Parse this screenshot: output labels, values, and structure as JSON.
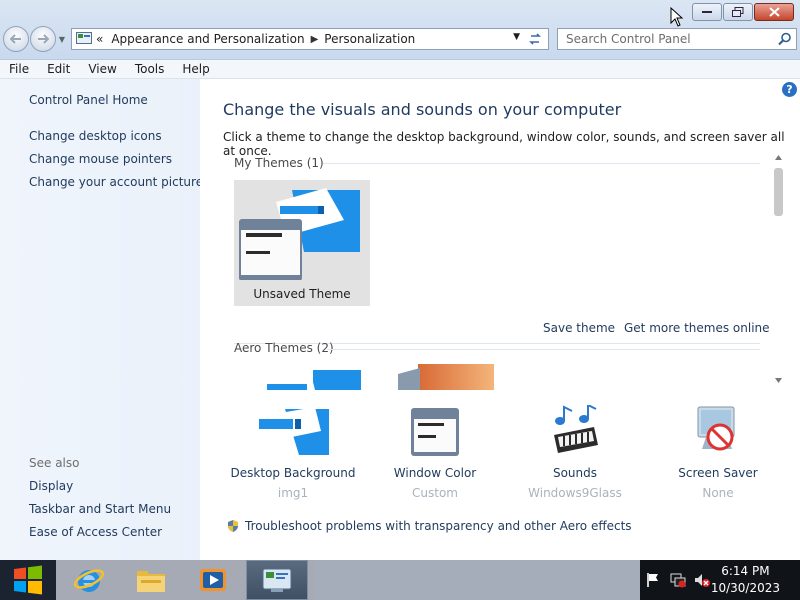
{
  "window": {
    "breadcrumb": [
      "Appearance and Personalization",
      "Personalization"
    ],
    "breadcrumb_overflow": "«",
    "search_placeholder": "Search Control Panel"
  },
  "menu": [
    "File",
    "Edit",
    "View",
    "Tools",
    "Help"
  ],
  "sidebar": {
    "home": "Control Panel Home",
    "links": [
      "Change desktop icons",
      "Change mouse pointers",
      "Change your account picture"
    ],
    "see_also_label": "See also",
    "see_also": [
      "Display",
      "Taskbar and Start Menu",
      "Ease of Access Center"
    ]
  },
  "main": {
    "heading": "Change the visuals and sounds on your computer",
    "subtitle": "Click a theme to change the desktop background, window color, sounds, and screen saver all at once.",
    "my_themes": "My Themes (1)",
    "current_theme": "Unsaved Theme",
    "save_theme": "Save theme",
    "get_more": "Get more themes online",
    "aero_themes": "Aero Themes (2)",
    "help": "?"
  },
  "settings": [
    {
      "label": "Desktop Background",
      "value": "img1"
    },
    {
      "label": "Window Color",
      "value": "Custom"
    },
    {
      "label": "Sounds",
      "value": "Windows9Glass"
    },
    {
      "label": "Screen Saver",
      "value": "None"
    }
  ],
  "troubleshoot": "Troubleshoot problems with transparency and other Aero effects",
  "taskbar": {
    "time": "6:14 PM",
    "date": "10/30/2023"
  },
  "colors": {
    "accent_blue": "#1e90e8",
    "link": "#1f3a5c",
    "sidebar_bg": "#eef4fb"
  }
}
